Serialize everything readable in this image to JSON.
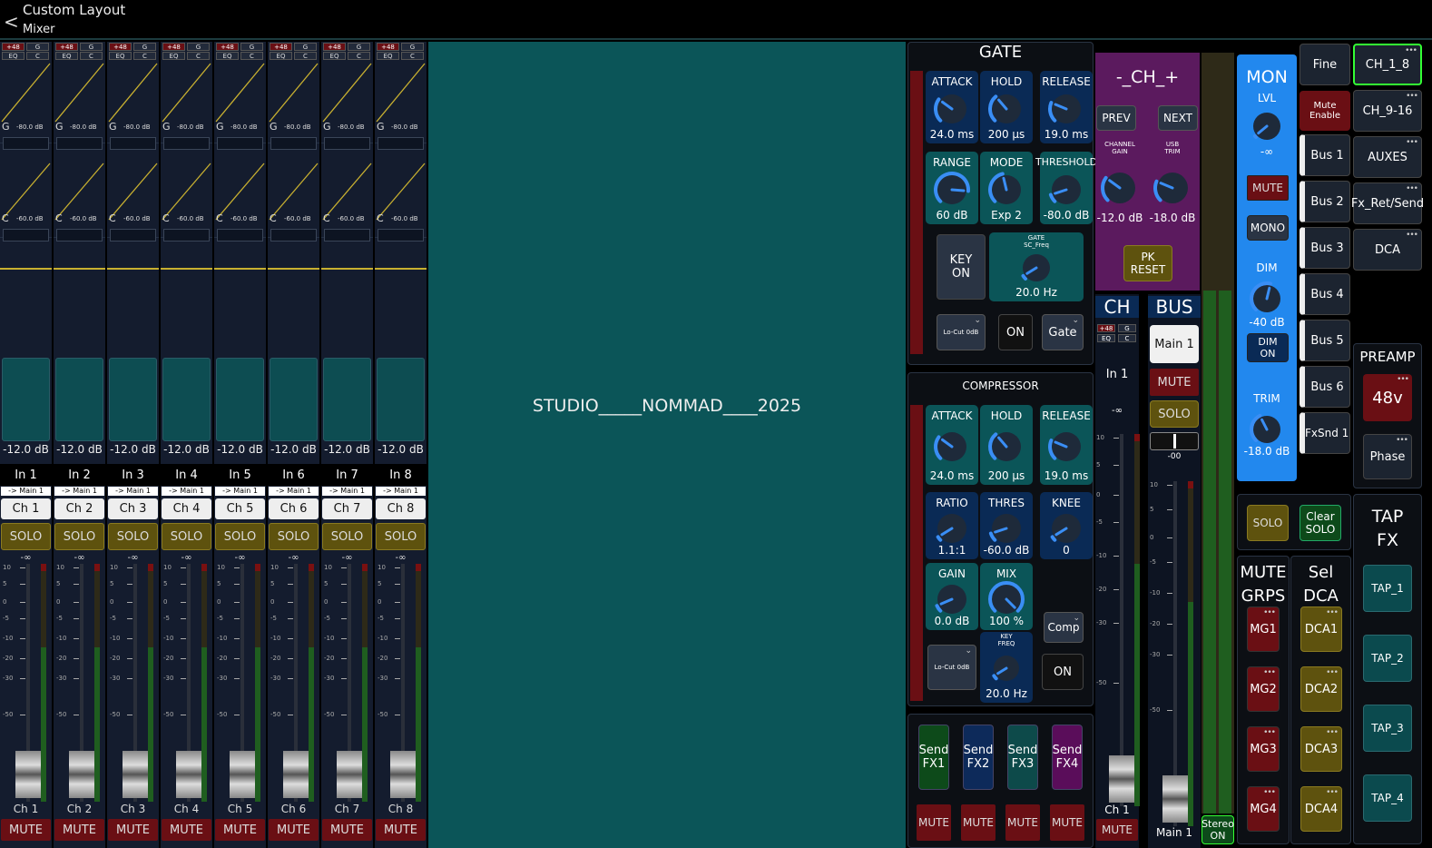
{
  "header": {
    "back": "<",
    "title": "Custom Layout",
    "subtitle": "Mixer"
  },
  "center_text": "STUDIO_____NOMMAD____2025",
  "strip_tags": {
    "p48": "+48",
    "g": "G",
    "eq": "EQ",
    "c": "C"
  },
  "strip_eq": {
    "gate_label": "G",
    "gate_value": "-80.0 dB",
    "comp_label": "C",
    "comp_value": "-60.0 dB"
  },
  "scale_marks": [
    "10",
    "5",
    "0",
    "-5",
    "-10",
    "-20",
    "-30",
    "-50"
  ],
  "inf_label": "-∞",
  "strips": [
    {
      "gain": "-12.0 dB",
      "name": "In 1",
      "route": "-> Main 1",
      "ch": "Ch 1",
      "solo": "SOLO",
      "label": "Ch 1",
      "mute": "MUTE"
    },
    {
      "gain": "-12.0 dB",
      "name": "In 2",
      "route": "-> Main 1",
      "ch": "Ch 2",
      "solo": "SOLO",
      "label": "Ch 2",
      "mute": "MUTE"
    },
    {
      "gain": "-12.0 dB",
      "name": "In 3",
      "route": "-> Main 1",
      "ch": "Ch 3",
      "solo": "SOLO",
      "label": "Ch 3",
      "mute": "MUTE"
    },
    {
      "gain": "-12.0 dB",
      "name": "In 4",
      "route": "-> Main 1",
      "ch": "Ch 4",
      "solo": "SOLO",
      "label": "Ch 4",
      "mute": "MUTE"
    },
    {
      "gain": "-12.0 dB",
      "name": "In 5",
      "route": "-> Main 1",
      "ch": "Ch 5",
      "solo": "SOLO",
      "label": "Ch 5",
      "mute": "MUTE"
    },
    {
      "gain": "-12.0 dB",
      "name": "In 6",
      "route": "-> Main 1",
      "ch": "Ch 6",
      "solo": "SOLO",
      "label": "Ch 6",
      "mute": "MUTE"
    },
    {
      "gain": "-12.0 dB",
      "name": "In 7",
      "route": "-> Main 1",
      "ch": "Ch 7",
      "solo": "SOLO",
      "label": "Ch 7",
      "mute": "MUTE"
    },
    {
      "gain": "-12.0 dB",
      "name": "In 8",
      "route": "-> Main 1",
      "ch": "Ch 8",
      "solo": "SOLO",
      "label": "Ch 8",
      "mute": "MUTE"
    }
  ],
  "gate": {
    "title": "GATE",
    "knobs": [
      {
        "label": "ATTACK",
        "value": "24.0 ms",
        "level": 0.3
      },
      {
        "label": "HOLD",
        "value": "200 μs",
        "level": 0.35
      },
      {
        "label": "RELEASE",
        "value": "19.0 ms",
        "level": 0.25
      },
      {
        "label": "RANGE",
        "value": "60 dB",
        "level": 0.85
      },
      {
        "label": "MODE",
        "value": "Exp 2",
        "level": 0.45
      },
      {
        "label": "THRESHOLD",
        "value": "-80.0 dB",
        "level": 0.1
      }
    ],
    "key": "KEY\nON",
    "sc_label": "GATE\nSC_Freq",
    "sc_value": "20.0 Hz",
    "sc_level": 0.05,
    "locut": "Lo-Cut 0dB",
    "on": "ON",
    "type": "Gate"
  },
  "comp": {
    "title": "COMPRESSOR",
    "knobs": [
      {
        "label": "ATTACK",
        "value": "24.0 ms",
        "level": 0.3
      },
      {
        "label": "HOLD",
        "value": "200 μs",
        "level": 0.35
      },
      {
        "label": "RELEASE",
        "value": "19.0 ms",
        "level": 0.25
      },
      {
        "label": "RATIO",
        "value": "1.1:1",
        "level": 0.05
      },
      {
        "label": "THRES",
        "value": "-60.0 dB",
        "level": 0.1
      },
      {
        "label": "KNEE",
        "value": "0",
        "level": 0.05
      },
      {
        "label": "GAIN",
        "value": "0.0 dB",
        "level": 0.08
      },
      {
        "label": "MIX",
        "value": "100 %",
        "level": 1.0
      }
    ],
    "key_label": "KEY\nFREQ",
    "key_value": "20.0 Hz",
    "key_level": 0.05,
    "type": "Comp",
    "locut": "Lo-Cut 0dB",
    "on": "ON"
  },
  "sends": [
    {
      "label": "Send\nFX1",
      "color": "#0d4a1a",
      "mute": "MUTE"
    },
    {
      "label": "Send\nFX2",
      "color": "#0d2a5a",
      "mute": "MUTE"
    },
    {
      "label": "Send\nFX3",
      "color": "#0d4a4a",
      "mute": "MUTE"
    },
    {
      "label": "Send\nFX4",
      "color": "#5a0d5a",
      "mute": "MUTE"
    }
  ],
  "chsel": {
    "title": "-_CH_+",
    "prev": "PREV",
    "next": "NEXT",
    "chgain_label": "CHANNEL\nGAIN",
    "chgain_value": "-12.0 dB",
    "chgain_level": 0.3,
    "usb_label": "USB\nTRIM",
    "usb_value": "-18.0 dB",
    "usb_level": 0.25,
    "pk": "PK\nRESET"
  },
  "ch_section": {
    "title": "CH",
    "name": "In 1",
    "label": "Ch 1",
    "mute": "MUTE"
  },
  "bus_section": {
    "title": "BUS",
    "main": "Main 1",
    "mute": "MUTE",
    "solo": "SOLO",
    "pan_value": "-00",
    "label": "Main 1"
  },
  "stereo_btn": "Stereo\nON",
  "mon": {
    "title": "MON",
    "lvl_label": "LVL",
    "lvl_value": "-∞",
    "lvl_level": 0.0,
    "mute": "MUTE",
    "mono": "MONO",
    "dim_label": "DIM",
    "dim_value": "-40 dB",
    "dim_level": 0.55,
    "dim_on": "DIM\nON",
    "trim_label": "TRIM",
    "trim_value": "-18.0 dB",
    "trim_level": 0.4
  },
  "fine": "Fine",
  "mute_enable": "Mute Enable",
  "buses": [
    "Bus 1",
    "Bus 2",
    "Bus 3",
    "Bus 4",
    "Bus 5",
    "Bus 6",
    "FxSnd 1"
  ],
  "banks": [
    "CH_1_8",
    "CH_9-16",
    "AUXES",
    "Fx_Ret/Send",
    "DCA"
  ],
  "preamp": {
    "title": "PREAMP",
    "phantom": "48v",
    "phase": "Phase"
  },
  "solo_btn": "SOLO",
  "clear_solo": "Clear\nSOLO",
  "mute_groups": {
    "title": "MUTE\nGRPS",
    "items": [
      "MG1",
      "MG2",
      "MG3",
      "MG4"
    ]
  },
  "sel_dca": {
    "title": "Sel\nDCA",
    "items": [
      "DCA1",
      "DCA2",
      "DCA3",
      "DCA4"
    ]
  },
  "tap_fx": {
    "title": "TAP\nFX",
    "items": [
      "TAP_1",
      "TAP_2",
      "TAP_3",
      "TAP_4"
    ]
  },
  "colors": {
    "teal": "#0b5558",
    "gate_bg": "#0a2a55",
    "mon_blue": "#2288ee",
    "solo": "#5e520e",
    "mute": "#6a0f14",
    "purple": "#5b1a5e"
  }
}
